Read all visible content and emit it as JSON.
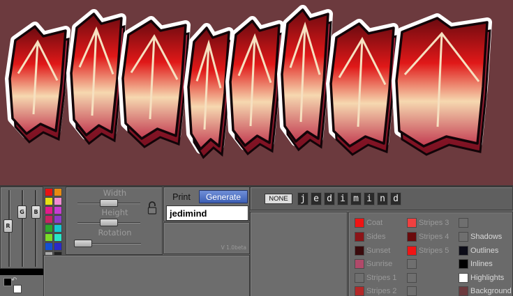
{
  "canvas": {
    "background": "#6c3a3e",
    "word": "jedimind"
  },
  "rgb": {
    "r_label": "R",
    "g_label": "G",
    "b_label": "B"
  },
  "palette": [
    "#e61414",
    "#e88b12",
    "#e6e014",
    "#f08cd2",
    "#e21b8c",
    "#c63cd2",
    "#c82464",
    "#8c3cc8",
    "#2ca82c",
    "#14c8d2",
    "#7cdc28",
    "#28e6c8",
    "#1450d2",
    "#2a2ac8",
    "#aaaaaa",
    "#222222"
  ],
  "sizes": {
    "width_label": "Width",
    "height_label": "Height",
    "rotation_label": "Rotation",
    "width_value": 0.5,
    "height_value": 0.5,
    "rotation_value": 0.0
  },
  "textbox": {
    "print_label": "Print",
    "generate_label": "Generate",
    "text_value": "jedimind"
  },
  "version": "V 1.0beta",
  "letters": {
    "none_label": "NONE",
    "items": [
      "j",
      "e",
      "d",
      "i",
      "m",
      "i",
      "n",
      "d"
    ]
  },
  "layers": [
    {
      "name": "Coat",
      "color": "#f01414",
      "col": 0,
      "row": 0
    },
    {
      "name": "Sides",
      "color": "#8c1418",
      "col": 0,
      "row": 1
    },
    {
      "name": "Sunset",
      "color": "#3a0a0c",
      "col": 0,
      "row": 2
    },
    {
      "name": "Sunrise",
      "color": "#b04a6a",
      "col": 0,
      "row": 3
    },
    {
      "name": "Stripes 1",
      "color": "#6f6f6f",
      "col": 0,
      "row": 4
    },
    {
      "name": "Stripes 2",
      "color": "#b42828",
      "col": 0,
      "row": 5
    },
    {
      "name": "Stripes 3",
      "color": "#f04040",
      "col": 1,
      "row": 0
    },
    {
      "name": "Stripes 4",
      "color": "#6a0a0c",
      "col": 1,
      "row": 1
    },
    {
      "name": "Stripes 5",
      "color": "#f01414",
      "col": 1,
      "row": 2
    },
    {
      "name": "",
      "color": "#6f6f6f",
      "col": 1,
      "row": 3
    },
    {
      "name": "",
      "color": "#6f6f6f",
      "col": 1,
      "row": 4
    },
    {
      "name": "",
      "color": "#6f6f6f",
      "col": 1,
      "row": 5
    },
    {
      "name": "",
      "color": "#6f6f6f",
      "col": 2,
      "row": 0
    },
    {
      "name": "Shadows",
      "color": "#6f6f6f",
      "col": 2,
      "row": 1,
      "on": true
    },
    {
      "name": "Outlines",
      "color": "#0c0c18",
      "col": 2,
      "row": 2,
      "on": true
    },
    {
      "name": "Inlines",
      "color": "#000000",
      "col": 2,
      "row": 3,
      "on": true
    },
    {
      "name": "Highlights",
      "color": "#ffffff",
      "col": 2,
      "row": 4,
      "on": true
    },
    {
      "name": "Background",
      "color": "#6c3a3e",
      "col": 2,
      "row": 5,
      "on": true
    }
  ]
}
